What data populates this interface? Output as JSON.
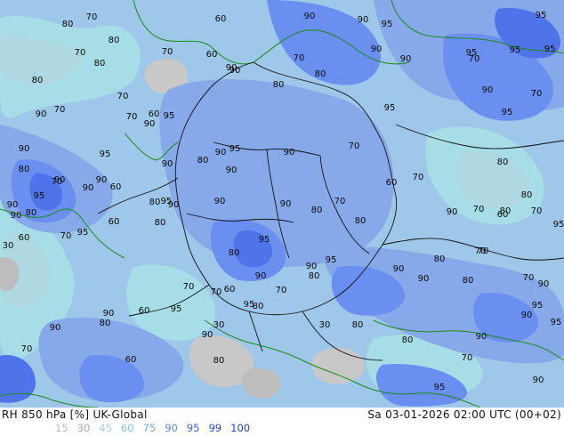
{
  "colors": {
    "c15": "#c8c8c8",
    "c30": "#bdbdbd",
    "c45": "#b0d8e2",
    "c60": "#a6dde6",
    "c75": "#9ec7e9",
    "c90": "#87a9ea",
    "c95": "#6b8ff0",
    "c99": "#4f73e8",
    "border": "#111111",
    "coast": "#1a8c1a"
  },
  "footer": {
    "title": "RH 850 hPa [%] UK-Global",
    "datetime": "Sa 03-01-2026 02:00 UTC (00+02)",
    "legend": [
      {
        "label": "15",
        "color": "#bcbcbc"
      },
      {
        "label": "30",
        "color": "#a9a9a9"
      },
      {
        "label": "45",
        "color": "#a6d3de"
      },
      {
        "label": "60",
        "color": "#7fc8d8"
      },
      {
        "label": "75",
        "color": "#72a8e3"
      },
      {
        "label": "90",
        "color": "#5b86e6"
      },
      {
        "label": "95",
        "color": "#3f63e2"
      },
      {
        "label": "99",
        "color": "#2c4bd8"
      },
      {
        "label": "100",
        "color": "#1f3ccc"
      }
    ]
  },
  "map_labels": [
    {
      "text": "70"
    },
    {
      "text": "80"
    },
    {
      "text": "60"
    },
    {
      "text": "90"
    },
    {
      "text": "95"
    },
    {
      "text": "80"
    },
    {
      "text": "70"
    },
    {
      "text": "60"
    },
    {
      "text": "70"
    },
    {
      "text": "90"
    },
    {
      "text": "80"
    },
    {
      "text": "90"
    },
    {
      "text": "70"
    },
    {
      "text": "95"
    },
    {
      "text": "90"
    },
    {
      "text": "95"
    },
    {
      "text": "80"
    },
    {
      "text": "70"
    },
    {
      "text": "80"
    },
    {
      "text": "90"
    },
    {
      "text": "90"
    },
    {
      "text": "70"
    },
    {
      "text": "95"
    },
    {
      "text": "95"
    },
    {
      "text": "80"
    },
    {
      "text": "90"
    },
    {
      "text": "70"
    },
    {
      "text": "70"
    },
    {
      "text": "60"
    },
    {
      "text": "95"
    },
    {
      "text": "90"
    },
    {
      "text": "95"
    },
    {
      "text": "90"
    },
    {
      "text": "95"
    },
    {
      "text": "70"
    },
    {
      "text": "90"
    },
    {
      "text": "95"
    },
    {
      "text": "90"
    },
    {
      "text": "95"
    },
    {
      "text": "80"
    },
    {
      "text": "90"
    },
    {
      "text": "90"
    },
    {
      "text": "90"
    },
    {
      "text": "80"
    },
    {
      "text": "70"
    },
    {
      "text": "80"
    },
    {
      "text": "70"
    },
    {
      "text": "80"
    },
    {
      "text": "60"
    },
    {
      "text": "90"
    },
    {
      "text": "90"
    },
    {
      "text": "90"
    },
    {
      "text": "95"
    },
    {
      "text": "60"
    },
    {
      "text": "70"
    },
    {
      "text": "90"
    },
    {
      "text": "80"
    },
    {
      "text": "90"
    },
    {
      "text": "80"
    },
    {
      "text": "30"
    },
    {
      "text": "95"
    },
    {
      "text": "80"
    },
    {
      "text": "90"
    },
    {
      "text": "70"
    },
    {
      "text": "70"
    },
    {
      "text": "60"
    },
    {
      "text": "80"
    },
    {
      "text": "90"
    },
    {
      "text": "95"
    },
    {
      "text": "95"
    },
    {
      "text": "90"
    },
    {
      "text": "80"
    },
    {
      "text": "70"
    },
    {
      "text": "80"
    },
    {
      "text": "60"
    },
    {
      "text": "95"
    },
    {
      "text": "70"
    },
    {
      "text": "90"
    },
    {
      "text": "60"
    },
    {
      "text": "80"
    },
    {
      "text": "70"
    },
    {
      "text": "80"
    },
    {
      "text": "70"
    },
    {
      "text": "90"
    },
    {
      "text": "80"
    },
    {
      "text": "90"
    },
    {
      "text": "95"
    },
    {
      "text": "70"
    },
    {
      "text": "80"
    },
    {
      "text": "70"
    },
    {
      "text": "90"
    },
    {
      "text": "80"
    },
    {
      "text": "70"
    },
    {
      "text": "60"
    },
    {
      "text": "90"
    },
    {
      "text": "70"
    },
    {
      "text": "90"
    },
    {
      "text": "95"
    },
    {
      "text": "30"
    },
    {
      "text": "60"
    },
    {
      "text": "90"
    },
    {
      "text": "80"
    },
    {
      "text": "95"
    },
    {
      "text": "80"
    },
    {
      "text": "90"
    },
    {
      "text": "60"
    },
    {
      "text": "70"
    },
    {
      "text": "90"
    },
    {
      "text": "30"
    },
    {
      "text": "80"
    },
    {
      "text": "95"
    },
    {
      "text": "95"
    },
    {
      "text": "90"
    },
    {
      "text": "90"
    },
    {
      "text": "80"
    },
    {
      "text": "70"
    },
    {
      "text": "90"
    },
    {
      "text": "95"
    }
  ]
}
